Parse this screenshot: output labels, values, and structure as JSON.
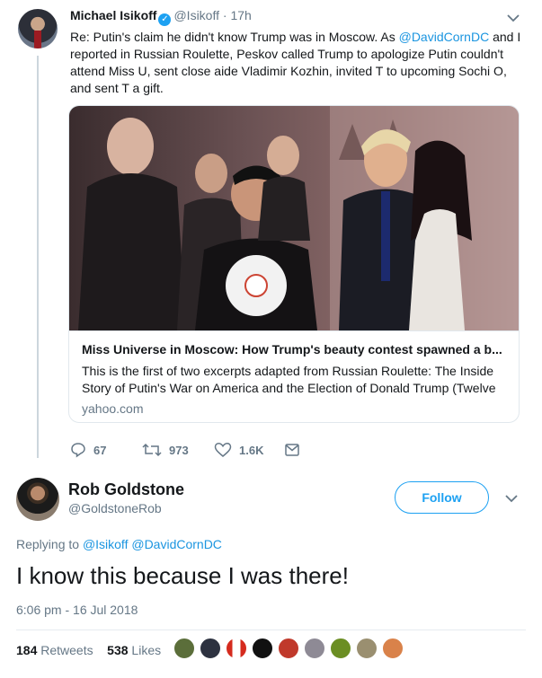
{
  "tweet1": {
    "name": "Michael Isikoff",
    "handle": "@Isikoff",
    "dot": "·",
    "time": "17h",
    "text_parts": [
      "Re: Putin's claim he didn't know Trump was in Moscow. As ",
      "@DavidCornDC",
      " and I reported in Russian Roulette, Peskov called Trump to apologize Putin couldn't attend Miss U, sent close aide Vladimir Kozhin, invited T to upcoming Sochi O, and sent T a gift."
    ],
    "card": {
      "title": "Miss Universe in Moscow: How Trump's beauty contest spawned a b...",
      "description": "This is the first of two excerpts adapted from Russian Roulette: The Inside Story of Putin's War on America and the Election of Donald Trump (Twelve",
      "domain": "yahoo.com"
    },
    "actions": {
      "reply_count": "67",
      "retweet_count": "973",
      "like_count": "1.6K"
    }
  },
  "tweet2": {
    "name": "Rob Goldstone",
    "handle": "@GoldstoneRob",
    "follow_label": "Follow",
    "replying_prefix": "Replying to",
    "replying_to": "@Isikoff @DavidCornDC",
    "text": "I know this because I was there!",
    "timestamp": "6:06 pm - 16 Jul 2018",
    "retweets_count": "184",
    "retweets_label": "Retweets",
    "likes_count": "538",
    "likes_label": "Likes"
  },
  "colors": {
    "accent": "#1da1f2",
    "link": "#1b95e0",
    "muted": "#657786"
  },
  "icons": [
    "verified-badge-icon",
    "chevron-down-icon",
    "reply-icon",
    "retweet-icon",
    "heart-icon",
    "message-icon"
  ]
}
